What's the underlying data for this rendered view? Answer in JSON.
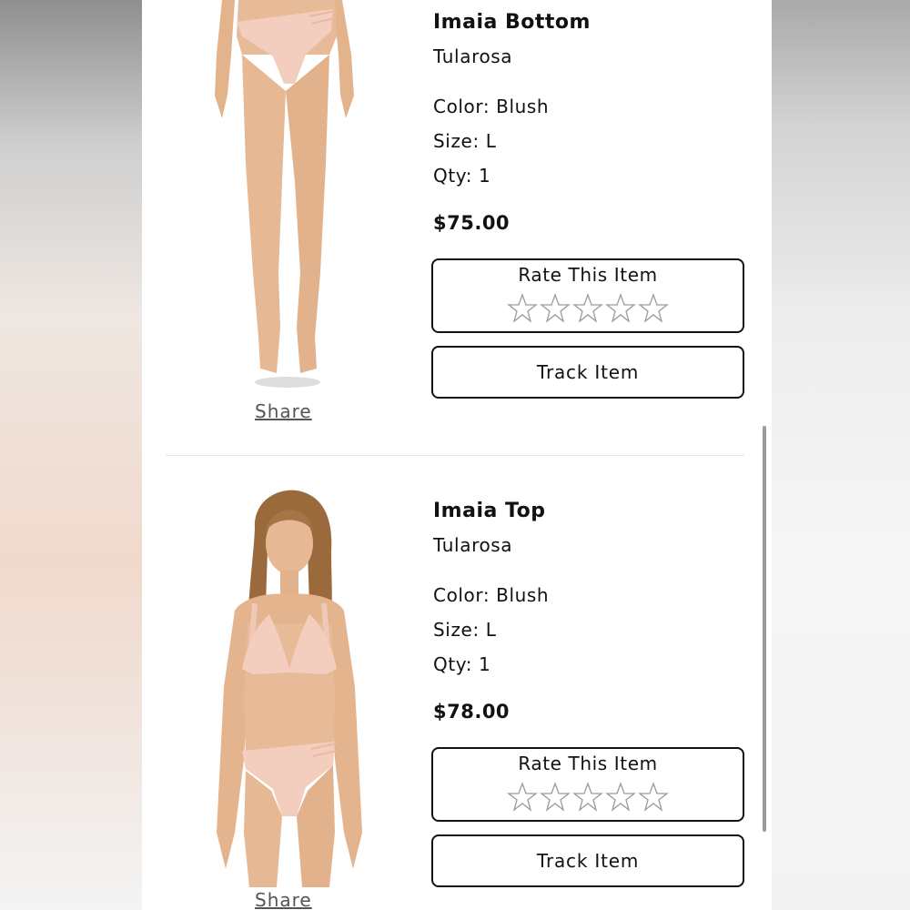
{
  "items": [
    {
      "title": "Imaia Bottom",
      "brand": "Tularosa",
      "color": "Color: Blush",
      "size": "Size: L",
      "qty": "Qty: 1",
      "price": "$75.00",
      "rate_label": "Rate This Item",
      "rating": 0,
      "track_label": "Track Item",
      "share_label": "Share"
    },
    {
      "title": "Imaia Top",
      "brand": "Tularosa",
      "color": "Color: Blush",
      "size": "Size: L",
      "qty": "Qty: 1",
      "price": "$78.00",
      "rate_label": "Rate This Item",
      "rating": 0,
      "track_label": "Track Item",
      "share_label": "Share"
    }
  ],
  "icons": {
    "star": "star-outline-icon"
  },
  "colors": {
    "text": "#111111",
    "skin": "#e6b894",
    "swim": "#f3cdbd",
    "hair": "#9a6a3d",
    "star_stroke": "#9a9a9a"
  }
}
